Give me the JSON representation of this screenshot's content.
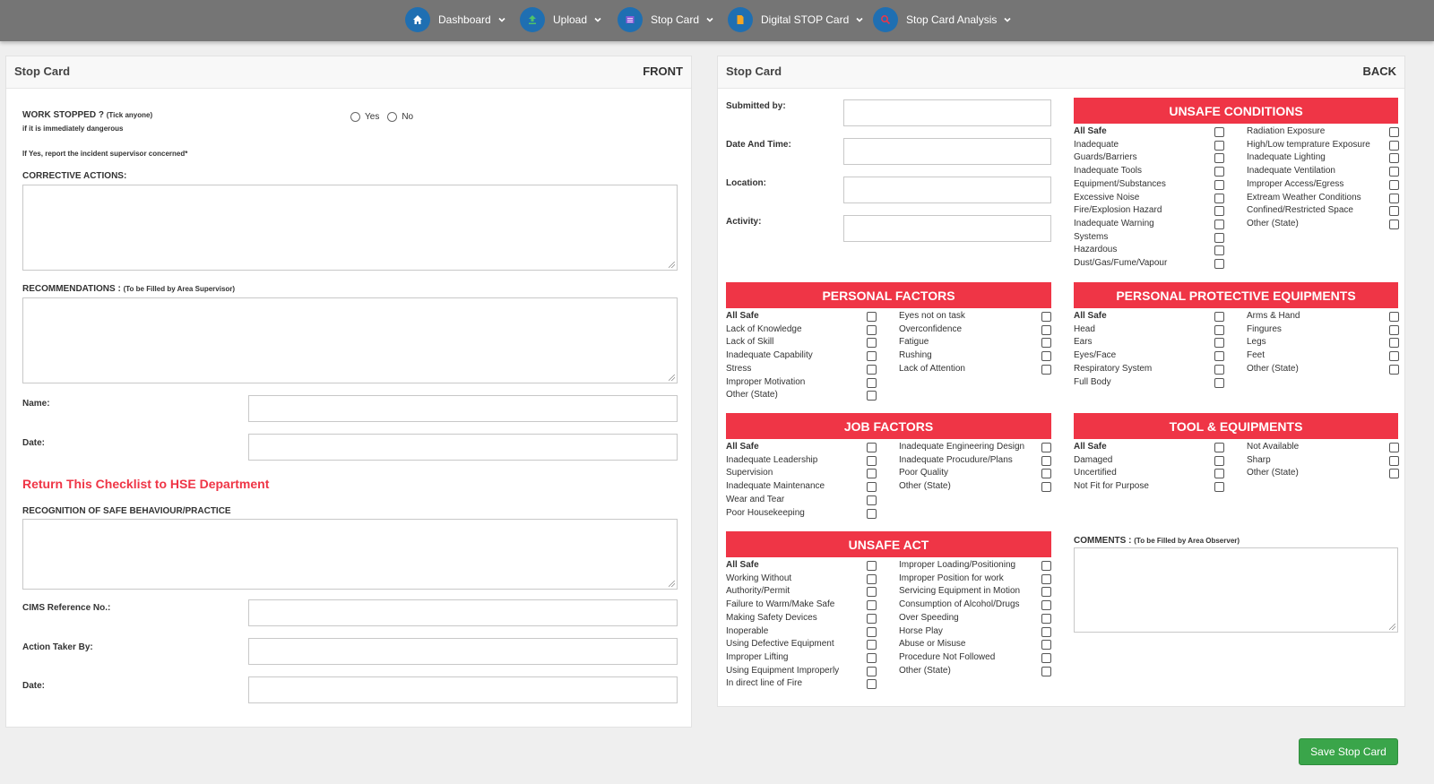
{
  "nav": {
    "items": [
      {
        "label": "Dashboard",
        "icon": "home-icon"
      },
      {
        "label": "Upload",
        "icon": "upload-icon"
      },
      {
        "label": "Stop Card",
        "icon": "list-icon"
      },
      {
        "label": "Digital STOP Card",
        "icon": "document-icon"
      },
      {
        "label": "Stop Card Analysis",
        "icon": "search-icon"
      }
    ]
  },
  "front": {
    "title": "Stop Card",
    "side": "FRONT",
    "work_stopped": "WORK STOPPED ?",
    "tick_anyone": "(Tick anyone)",
    "immediately": "if it is immediately dangerous",
    "yes": "Yes",
    "no": "No",
    "if_yes": "If Yes, report the incident supervisor concerned*",
    "corrective": "CORRECTIVE ACTIONS:",
    "recommendations": "RECOMMENDATIONS :",
    "rec_sub": "(To be Filled by Area Supervisor)",
    "name": "Name:",
    "date": "Date:",
    "return": "Return This Checklist to HSE Department",
    "recognition": "RECOGNITION OF SAFE BEHAVIOUR/PRACTICE",
    "cims": "CIMS Reference No.:",
    "action_taker": "Action Taker By:",
    "date2": "Date:"
  },
  "back": {
    "title": "Stop Card",
    "side": "BACK",
    "submitted_by": "Submitted by:",
    "date_time": "Date And Time:",
    "location": "Location:",
    "activity": "Activity:",
    "comments": "COMMENTS :",
    "comments_sub": "(To be Filled by Area Observer)",
    "sections": {
      "unsafe_conditions": {
        "title": "UNSAFE CONDITIONS",
        "col1": [
          "All Safe",
          "Inadequate",
          "Guards/Barriers",
          "Inadequate Tools",
          "Equipment/Substances",
          "Excessive Noise",
          "Fire/Explosion Hazard",
          "Inadequate Warning",
          "Systems",
          "Hazardous",
          "Dust/Gas/Fume/Vapour"
        ],
        "col2": [
          "Radiation Exposure",
          "High/Low temprature Exposure",
          "Inadequate Lighting",
          "Inadequate Ventilation",
          "Improper Access/Egress",
          "Extream Weather Conditions",
          "Confined/Restricted Space",
          "Other (State)"
        ]
      },
      "personal_factors": {
        "title": "PERSONAL FACTORS",
        "col1": [
          "All Safe",
          "Lack of Knowledge",
          "Lack of Skill",
          "Inadequate Capability",
          "Stress",
          "Improper Motivation",
          "Other (State)"
        ],
        "col2": [
          "Eyes not on task",
          "Overconfidence",
          "Fatigue",
          "Rushing",
          "Lack of Attention"
        ]
      },
      "ppe": {
        "title": "PERSONAL PROTECTIVE EQUIPMENTS",
        "col1": [
          "All Safe",
          "Head",
          "Ears",
          "Eyes/Face",
          "Respiratory System",
          "Full Body"
        ],
        "col2": [
          "Arms & Hand",
          "Fingures",
          "Legs",
          "Feet",
          "Other (State)"
        ]
      },
      "job_factors": {
        "title": "JOB FACTORS",
        "col1": [
          "All Safe",
          "Inadequate Leadership",
          "Supervision",
          "Inadequate Maintenance",
          "Wear and Tear",
          "Poor Housekeeping"
        ],
        "col2": [
          "Inadequate Engineering Design",
          "Inadequate Procudure/Plans",
          "Poor Quality",
          "Other (State)"
        ]
      },
      "tools": {
        "title": "TOOL & EQUIPMENTS",
        "col1": [
          "All Safe",
          "Damaged",
          "Uncertified",
          "Not Fit for Purpose"
        ],
        "col2": [
          "Not Available",
          "Sharp",
          "Other (State)"
        ]
      },
      "unsafe_act": {
        "title": "UNSAFE ACT",
        "col1": [
          "All Safe",
          "Working Without",
          "Authority/Permit",
          "Failure to Warm/Make Safe",
          "Making Safety Devices",
          "Inoperable",
          "Using Defective Equipment",
          "Improper Lifting",
          "Using Equipment Improperly",
          "In direct line of Fire"
        ],
        "col2": [
          "Improper Loading/Positioning",
          "Improper Position for work",
          "Servicing Equipment in Motion",
          "Consumption of Alcohol/Drugs",
          "Over Speeding",
          "Horse Play",
          "Abuse or Misuse",
          "Procedure Not Followed",
          "Other (State)"
        ]
      }
    }
  },
  "save_button": "Save Stop Card",
  "colors": {
    "banner": "#ef3546",
    "nav": "#757575",
    "nav_icon": "#1f6fb2",
    "save": "#3aa54a"
  }
}
